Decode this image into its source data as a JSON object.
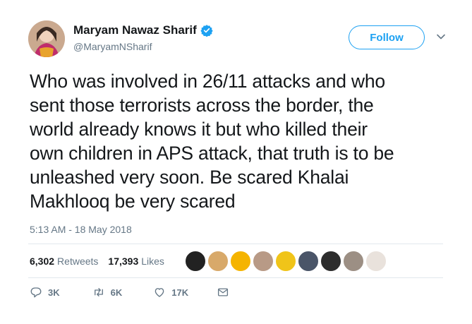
{
  "author": {
    "display_name": "Maryam Nawaz Sharif",
    "handle": "@MaryamNSharif",
    "verified": true
  },
  "header": {
    "follow_label": "Follow"
  },
  "tweet": {
    "text_lines": [
      "Who was involved in 26/11 attacks and who",
      "sent those terrorists across the border, the",
      "world already knows it but who killed their",
      "own children in APS attack, that truth is to be",
      "unleashed very soon. Be scared Khalai",
      "Makhlooq be very scared"
    ],
    "timestamp": "5:13 AM - 18 May 2018"
  },
  "stats": {
    "retweets_count": "6,302",
    "retweets_label": "Retweets",
    "likes_count": "17,393",
    "likes_label": "Likes"
  },
  "actions": {
    "reply_count": "3K",
    "retweet_count": "6K",
    "like_count": "17K"
  },
  "colors": {
    "accent": "#1da1f2",
    "secondary_text": "#657786",
    "divider": "#e1e8ed"
  }
}
